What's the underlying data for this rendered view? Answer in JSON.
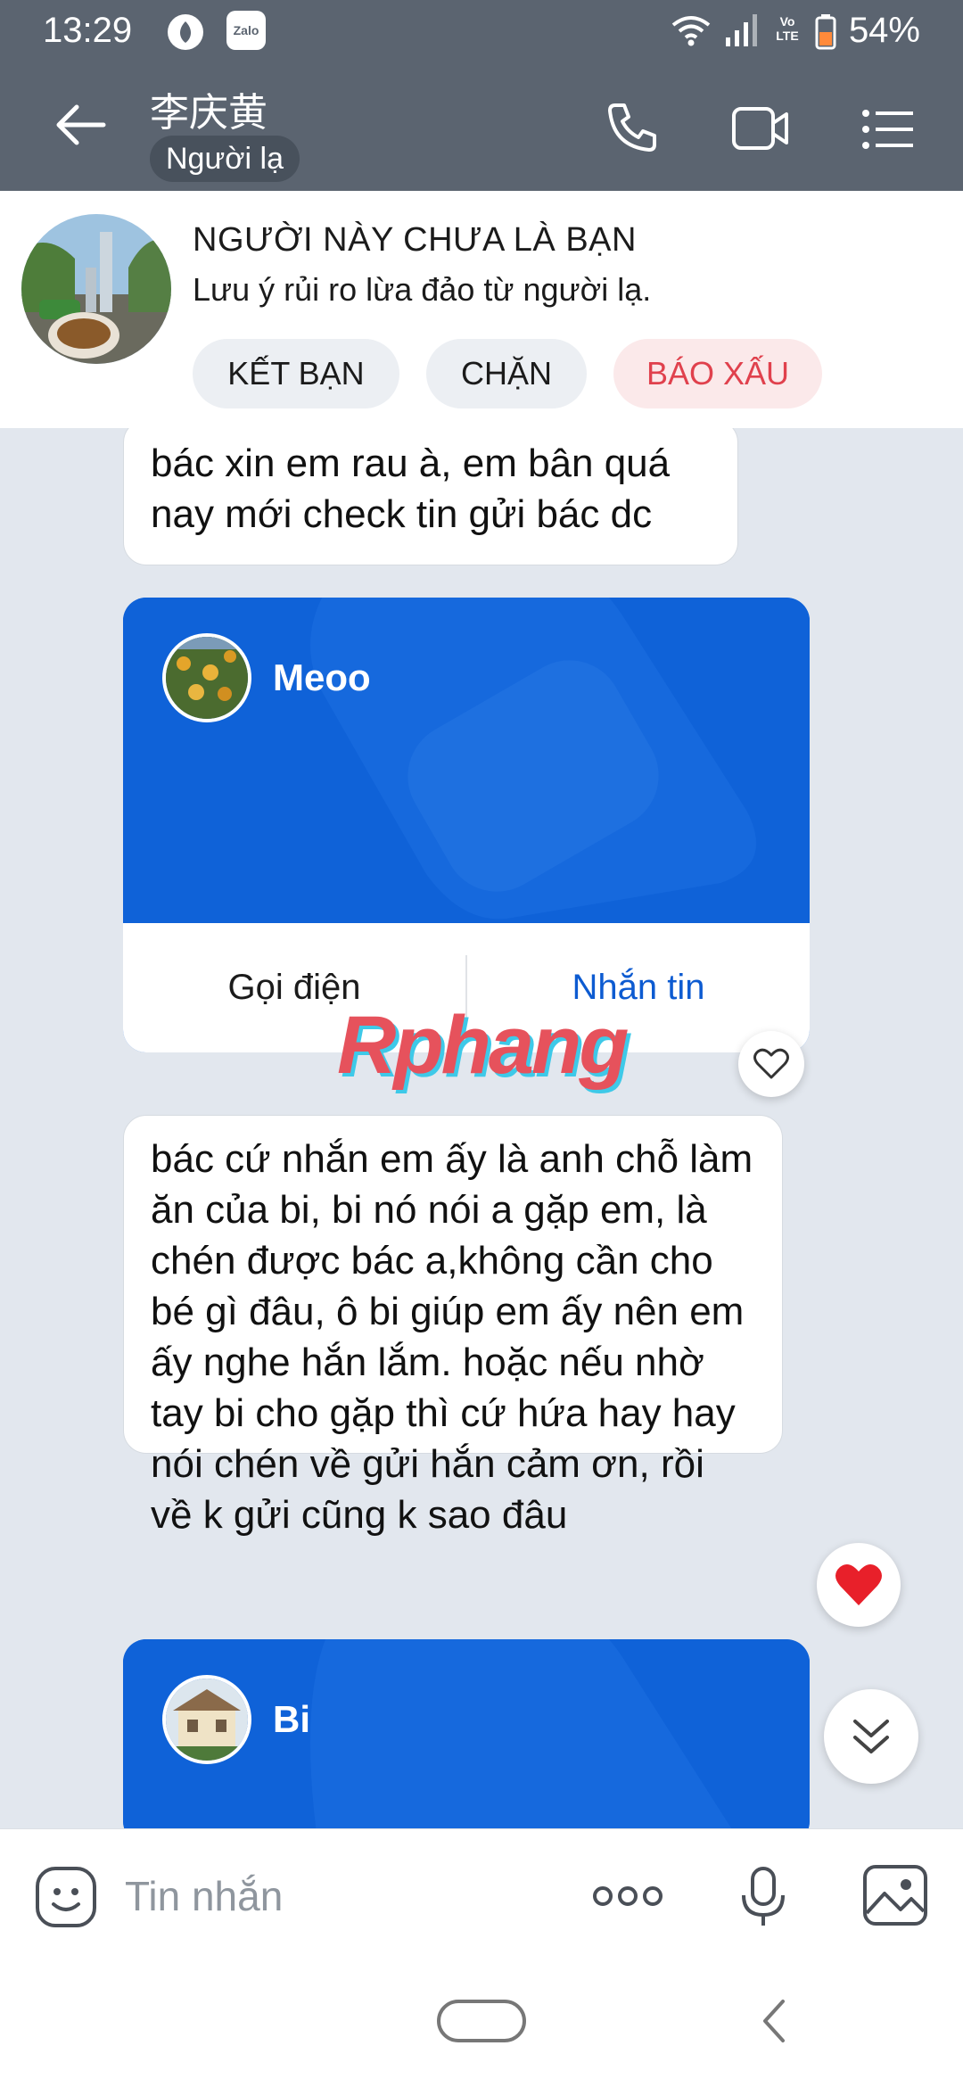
{
  "status_bar": {
    "time": "13:29",
    "battery": "54%",
    "icons": [
      "vietnam-app-icon",
      "zalo-icon",
      "wifi-icon",
      "signal-icon",
      "volte-icon",
      "battery-icon"
    ],
    "zalo_label": "Zalo",
    "volte_label": "Vo LTE"
  },
  "header": {
    "contact_name": "李庆黄",
    "badge": "Người lạ",
    "icons": [
      "back-arrow-icon",
      "phone-icon",
      "video-call-icon",
      "menu-list-icon"
    ]
  },
  "banner": {
    "title": "NGƯỜI NÀY CHƯA LÀ BẠN",
    "subtitle": "Lưu ý rủi ro lừa đảo từ người lạ.",
    "add_friend": "KẾT BẠN",
    "block": "CHẶN",
    "report": "BÁO XẤU",
    "report_color": "#e0414d",
    "report_bg": "#fbe9ea"
  },
  "messages": {
    "m1": "bác xin em rau à, em bân quá nay mới check tin gửi bác dc",
    "card1": {
      "name": "Meoo",
      "call": "Gọi điện",
      "message": "Nhắn tin"
    },
    "m2": "bác cứ nhắn em ấy là anh chỗ làm ăn của bi, bi nó nói a gặp em, là chén được bác a,không cần cho bé gì đâu,  ô bi giúp em ấy nên em ấy nghe hắn lắm. hoặc nếu nhờ tay bi cho gặp thì cứ hứa hay hay nói chén về gửi hắn cảm ơn, rồi về k gửi cũng k sao đâu",
    "card2": {
      "name": "Bi"
    }
  },
  "watermark": "Rphang",
  "input": {
    "placeholder": "Tin nhắn",
    "icons": [
      "sticker-icon",
      "more-icon",
      "voice-icon",
      "image-icon"
    ]
  },
  "colors": {
    "header_bg": "#5b6470",
    "card_blue": "#0f62d8",
    "link_blue": "#0d5bd1",
    "chat_bg": "#e2e7ee"
  }
}
